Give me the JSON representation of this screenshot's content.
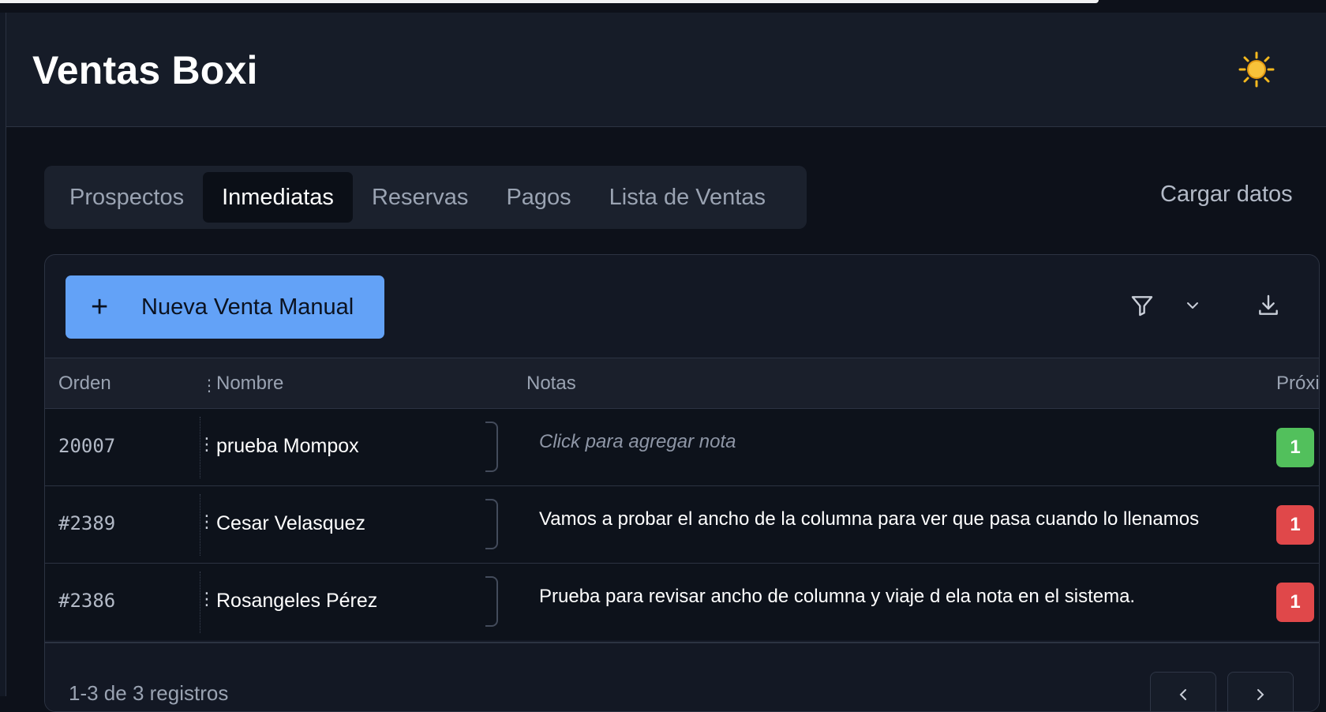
{
  "app": {
    "title": "Ventas Boxi"
  },
  "theme_toggle": {
    "icon": "sun-icon",
    "color": "#f5b91e"
  },
  "tabs": [
    {
      "label": "Prospectos",
      "active": false
    },
    {
      "label": "Inmediatas",
      "active": true
    },
    {
      "label": "Reservas",
      "active": false
    },
    {
      "label": "Pagos",
      "active": false
    },
    {
      "label": "Lista de Ventas",
      "active": false
    }
  ],
  "load_data_label": "Cargar datos",
  "toolbar": {
    "new_sale_label": "Nueva Venta Manual",
    "accent_color": "#63a2f7"
  },
  "table": {
    "columns": [
      "Orden",
      "Nombre",
      "Notas",
      "Próxi"
    ],
    "rows": [
      {
        "orden": "20007",
        "nombre": "prueba Mompox",
        "nota": "Click para agregar nota",
        "nota_placeholder": true,
        "badge": "1",
        "badge_color": "#52c05c"
      },
      {
        "orden": "#2389",
        "nombre": "Cesar Velasquez",
        "nota": "Vamos a probar el ancho de la columna para ver que pasa cuando lo llenamos",
        "nota_placeholder": false,
        "badge": "1",
        "badge_color": "#e0484a"
      },
      {
        "orden": "#2386",
        "nombre": "Rosangeles Pérez",
        "nota": "Prueba para revisar ancho de columna y viaje d ela nota en el sistema.",
        "nota_placeholder": false,
        "badge": "1",
        "badge_color": "#e0484a"
      }
    ]
  },
  "pagination": {
    "summary": "1-3 de 3 registros"
  }
}
